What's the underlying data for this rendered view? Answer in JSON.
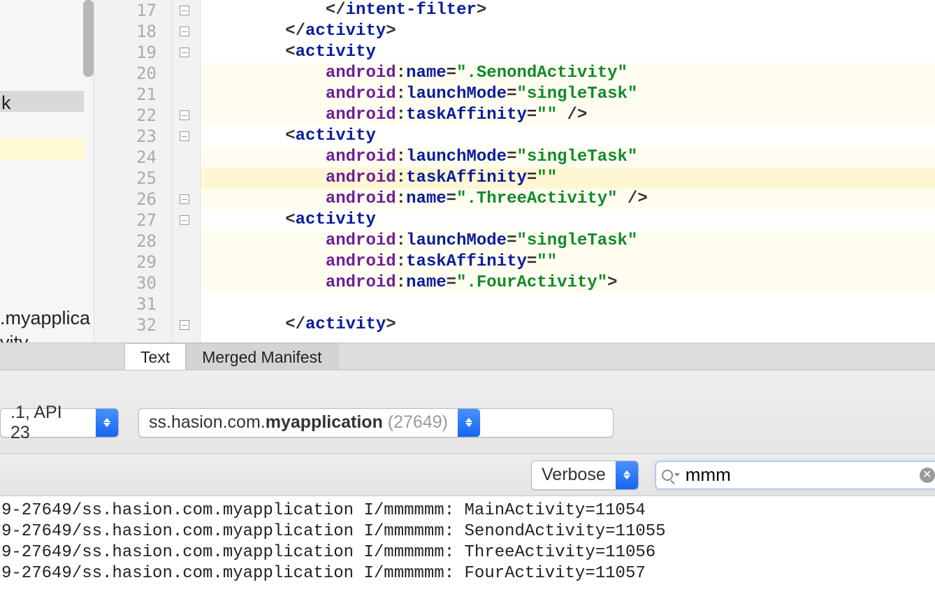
{
  "sidebar": {
    "item_k": "k",
    "item_myapp": ".myapplica",
    "item_vity": "vity"
  },
  "editor": {
    "line_start": 17,
    "lines": {
      "l17": {
        "i": 3,
        "t": "tag_close",
        "name": "intent-filter"
      },
      "l18": {
        "i": 2,
        "t": "tag_close",
        "name": "activity"
      },
      "l19": {
        "i": 2,
        "t": "tag_open",
        "name": "activity"
      },
      "l20": {
        "i": 3,
        "t": "attr",
        "ns": "android",
        "a": "name",
        "v": ".SenondActivity"
      },
      "l21": {
        "i": 3,
        "t": "attr",
        "ns": "android",
        "a": "launchMode",
        "v": "singleTask"
      },
      "l22": {
        "i": 3,
        "t": "attr",
        "ns": "android",
        "a": "taskAffinity",
        "v": "",
        "close": " />"
      },
      "l23": {
        "i": 2,
        "t": "tag_open",
        "name": "activity"
      },
      "l24": {
        "i": 3,
        "t": "attr",
        "ns": "android",
        "a": "launchMode",
        "v": "singleTask"
      },
      "l25": {
        "i": 3,
        "t": "attr",
        "ns": "android",
        "a": "taskAffinity",
        "v": "",
        "hl": true
      },
      "l26": {
        "i": 3,
        "t": "attr",
        "ns": "android",
        "a": "name",
        "v": ".ThreeActivity",
        "close": " />"
      },
      "l27": {
        "i": 2,
        "t": "tag_open",
        "name": "activity"
      },
      "l28": {
        "i": 3,
        "t": "attr",
        "ns": "android",
        "a": "launchMode",
        "v": "singleTask"
      },
      "l29": {
        "i": 3,
        "t": "attr",
        "ns": "android",
        "a": "taskAffinity",
        "v": ""
      },
      "l30": {
        "i": 3,
        "t": "attr",
        "ns": "android",
        "a": "name",
        "v": ".FourActivity",
        "close": ">"
      },
      "l31": {
        "i": 0,
        "t": "blank"
      },
      "l32": {
        "i": 2,
        "t": "tag_close",
        "name": "activity"
      }
    },
    "visible_lines": 16
  },
  "tabs": {
    "text": "Text",
    "merged": "Merged Manifest",
    "active": "text"
  },
  "devicebar": {
    "api_label": ".1, API 23",
    "process_prefix": "ss.hasion.com.",
    "process_bold": "myapplication",
    "process_pid": "(27649)"
  },
  "filterbar": {
    "level": "Verbose",
    "search_value": "mmm"
  },
  "logcat": {
    "rows": [
      "9-27649/ss.hasion.com.myapplication I/mmmmmm: MainActivity=11054",
      "9-27649/ss.hasion.com.myapplication I/mmmmmm: SenondActivity=11055",
      "9-27649/ss.hasion.com.myapplication I/mmmmmm: ThreeActivity=11056",
      "9-27649/ss.hasion.com.myapplication I/mmmmmm: FourActivity=11057"
    ]
  }
}
